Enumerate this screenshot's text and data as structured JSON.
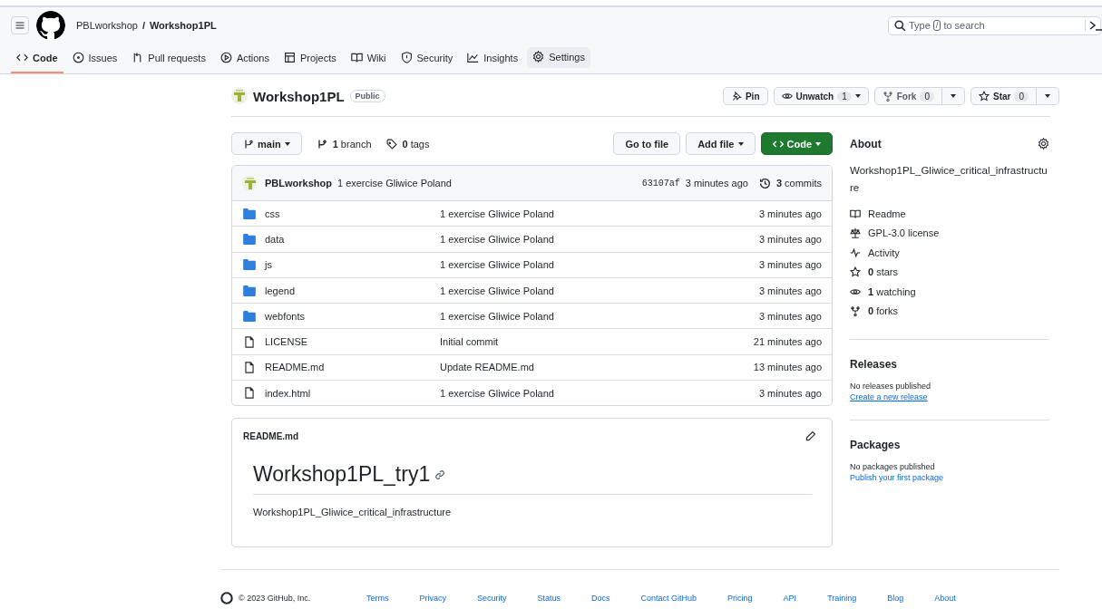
{
  "header": {
    "owner": "PBLworkshop",
    "separator": "/",
    "repo": "Workshop1PL",
    "search": {
      "prefix": "Type",
      "key": "/",
      "suffix": "to search"
    }
  },
  "tabs": [
    {
      "label": "Code",
      "selected": true
    },
    {
      "label": "Issues",
      "selected": false
    },
    {
      "label": "Pull requests",
      "selected": false
    },
    {
      "label": "Actions",
      "selected": false
    },
    {
      "label": "Projects",
      "selected": false
    },
    {
      "label": "Wiki",
      "selected": false
    },
    {
      "label": "Security",
      "selected": false
    },
    {
      "label": "Insights",
      "selected": false
    },
    {
      "label": "Settings",
      "selected": false
    }
  ],
  "repo": {
    "name": "Workshop1PL",
    "visibility": "Public",
    "pin": "Pin",
    "watch": {
      "label": "Unwatch",
      "count": "1"
    },
    "fork": {
      "label": "Fork",
      "count": "0"
    },
    "star": {
      "label": "Star",
      "count": "0"
    }
  },
  "toolbar": {
    "branch": "main",
    "branches": "**1** branch",
    "tags": "**0** tags",
    "go_to_file": "Go to file",
    "add_file": "Add file",
    "code": "Code"
  },
  "commit": {
    "author": "PBLworkshop",
    "message": "1 exercise Gliwice Poland",
    "hash": "63107af",
    "time": "3 minutes ago",
    "commits": "**3** commits"
  },
  "files": [
    {
      "name": "css",
      "kind": "dir",
      "message": "1 exercise Gliwice Poland",
      "time": "3 minutes ago"
    },
    {
      "name": "data",
      "kind": "dir",
      "message": "1 exercise Gliwice Poland",
      "time": "3 minutes ago"
    },
    {
      "name": "js",
      "kind": "dir",
      "message": "1 exercise Gliwice Poland",
      "time": "3 minutes ago"
    },
    {
      "name": "legend",
      "kind": "dir",
      "message": "1 exercise Gliwice Poland",
      "time": "3 minutes ago"
    },
    {
      "name": "webfonts",
      "kind": "dir",
      "message": "1 exercise Gliwice Poland",
      "time": "3 minutes ago"
    },
    {
      "name": "LICENSE",
      "kind": "file",
      "message": "Initial commit",
      "time": "21 minutes ago"
    },
    {
      "name": "README.md",
      "kind": "file",
      "message": "Update README.md",
      "time": "13 minutes ago"
    },
    {
      "name": "index.html",
      "kind": "file",
      "message": "1 exercise Gliwice Poland",
      "time": "3 minutes ago"
    }
  ],
  "readme": {
    "filename": "README.md",
    "heading": "Workshop1PL_try1",
    "text": "Workshop1PL_Gliwice_critical_infrastructure"
  },
  "about": {
    "title": "About",
    "description": "Workshop1PL_Gliwice_critical_infrastructure",
    "items": [
      "Readme",
      "GPL-3.0 license",
      "Activity",
      "**0** stars",
      "**1** watching",
      "**0** forks"
    ]
  },
  "releases": {
    "title": "Releases",
    "note": "No releases published",
    "link": "Create a new release"
  },
  "packages": {
    "title": "Packages",
    "note": "No packages published",
    "link": "Publish your first package"
  },
  "footer": {
    "copyright": "© 2023 GitHub, Inc.",
    "links": [
      "Terms",
      "Privacy",
      "Security",
      "Status",
      "Docs",
      "Contact GitHub",
      "Pricing",
      "API",
      "Training",
      "Blog",
      "About"
    ]
  }
}
